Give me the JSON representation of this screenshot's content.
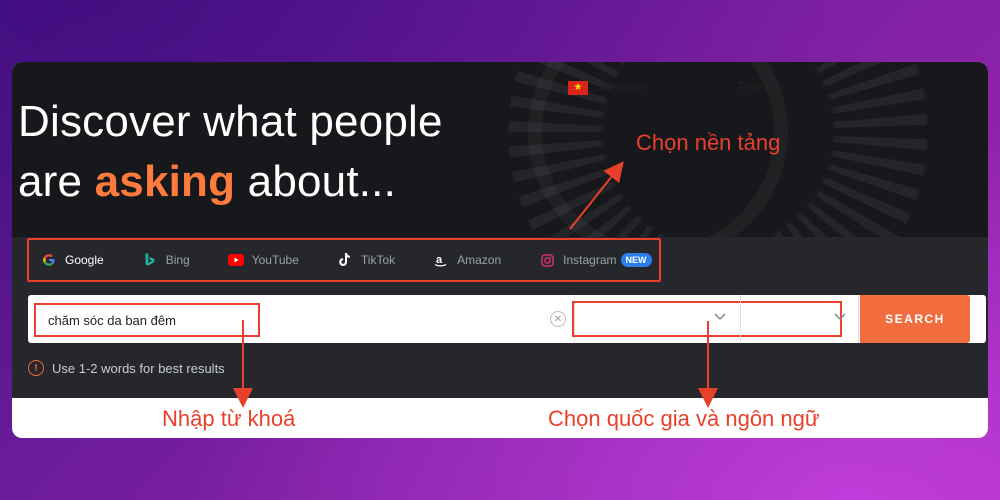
{
  "hero": {
    "line1": "Discover what people",
    "line2_pre": "are ",
    "line2_accent": "asking",
    "line2_post": " about..."
  },
  "tabs": [
    {
      "label": "Google",
      "icon": "google-icon",
      "active": true
    },
    {
      "label": "Bing",
      "icon": "bing-icon",
      "active": false
    },
    {
      "label": "YouTube",
      "icon": "youtube-icon",
      "active": false
    },
    {
      "label": "TikTok",
      "icon": "tiktok-icon",
      "active": false
    },
    {
      "label": "Amazon",
      "icon": "amazon-icon",
      "active": false
    },
    {
      "label": "Instagram",
      "icon": "instagram-icon",
      "active": false,
      "badge": "NEW"
    }
  ],
  "search": {
    "keyword_value": "chăm sóc da ban đêm",
    "clear_symbol": "✕",
    "country": "Vietnam",
    "language": "Polish",
    "button_label": "SEARCH"
  },
  "hint": {
    "icon_symbol": "!",
    "text": "Use 1-2 words for best results"
  },
  "annotations": {
    "platform": "Chọn nền tảng",
    "keyword": "Nhập từ khoá",
    "country_language": "Chọn quốc gia và ngôn ngữ"
  },
  "colors": {
    "accent": "#f26d3d",
    "annotation_red": "#e8402a",
    "dark_bg": "#17181b",
    "panel_bg": "#25272b"
  }
}
